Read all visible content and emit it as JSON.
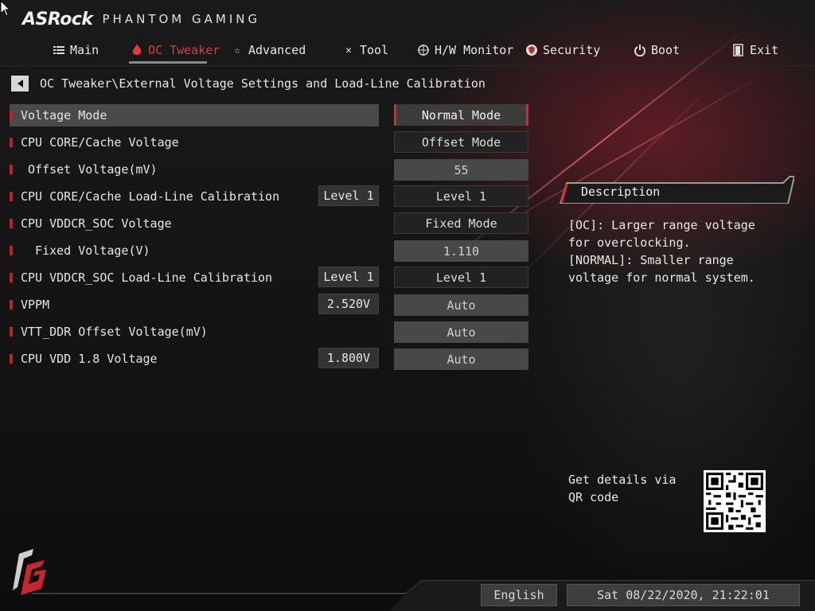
{
  "brand": {
    "name": "ASRock",
    "subtitle": "PHANTOM GAMING"
  },
  "nav": {
    "items": [
      {
        "label": "Main",
        "icon": "list-icon"
      },
      {
        "label": "OC Tweaker",
        "icon": "flame-icon",
        "active": true
      },
      {
        "label": "Advanced",
        "icon": "star-icon"
      },
      {
        "label": "Tool",
        "icon": "tools-icon"
      },
      {
        "label": "H/W Monitor",
        "icon": "crosshair-icon"
      },
      {
        "label": "Security",
        "icon": "shield-icon"
      },
      {
        "label": "Boot",
        "icon": "power-icon"
      },
      {
        "label": "Exit",
        "icon": "exit-door-icon"
      }
    ]
  },
  "breadcrumb": "OC Tweaker\\External Voltage Settings and Load-Line Calibration",
  "settings": [
    {
      "label": "Voltage Mode",
      "value": "Normal Mode"
    },
    {
      "label": "CPU CORE/Cache Voltage",
      "value": "Offset Mode"
    },
    {
      "label": " Offset Voltage(mV)",
      "value": "55"
    },
    {
      "label": "CPU CORE/Cache Load-Line Calibration",
      "current": "Level 1",
      "value": "Level 1"
    },
    {
      "label": "CPU VDDCR_SOC Voltage",
      "value": "Fixed Mode"
    },
    {
      "label": "  Fixed Voltage(V)",
      "value": "1.110"
    },
    {
      "label": "CPU VDDCR_SOC Load-Line Calibration",
      "current": "Level 1",
      "value": "Level 1"
    },
    {
      "label": "VPPM",
      "current": "2.520V",
      "value": "Auto"
    },
    {
      "label": "VTT_DDR Offset Voltage(mV)",
      "value": "Auto"
    },
    {
      "label": "CPU VDD 1.8 Voltage",
      "current": "1.800V",
      "value": "Auto"
    }
  ],
  "description": {
    "title": "Description",
    "text": "[OC]: Larger range voltage for overclocking.\n[NORMAL]: Smaller range voltage for normal system."
  },
  "qr": {
    "label": "Get details via QR code"
  },
  "footer": {
    "language": "English",
    "datetime": "Sat 08/22/2020, 21:22:01"
  },
  "colors": {
    "accent": "#d42a2a",
    "background": "#121212"
  }
}
